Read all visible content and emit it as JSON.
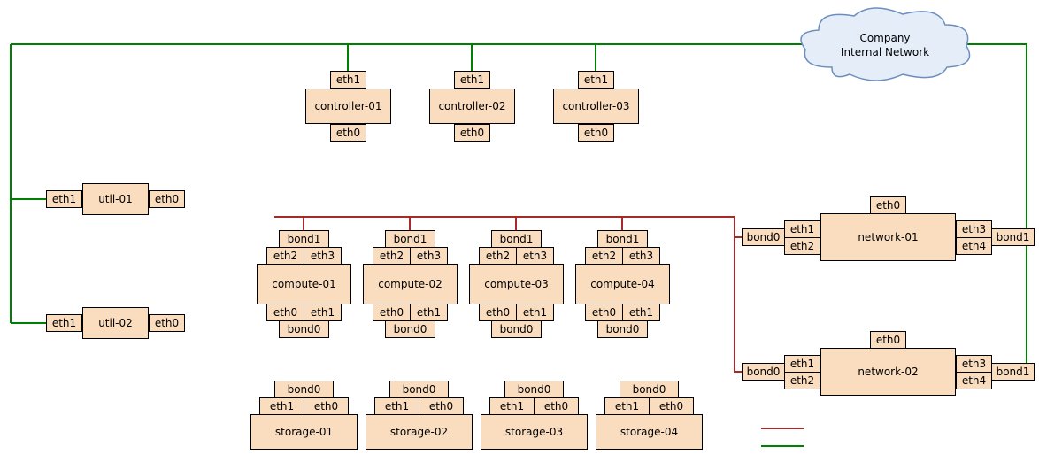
{
  "cloud": {
    "line1": "Company",
    "line2": "Internal Network"
  },
  "controllers": [
    {
      "name": "controller-01",
      "top": "eth1",
      "bottom": "eth0"
    },
    {
      "name": "controller-02",
      "top": "eth1",
      "bottom": "eth0"
    },
    {
      "name": "controller-03",
      "top": "eth1",
      "bottom": "eth0"
    }
  ],
  "utils": [
    {
      "name": "util-01",
      "left": "eth1",
      "right": "eth0"
    },
    {
      "name": "util-02",
      "left": "eth1",
      "right": "eth0"
    }
  ],
  "computes": [
    {
      "name": "compute-01",
      "topBond": "bond1",
      "topA": "eth2",
      "topB": "eth3",
      "botA": "eth0",
      "botB": "eth1",
      "botBond": "bond0"
    },
    {
      "name": "compute-02",
      "topBond": "bond1",
      "topA": "eth2",
      "topB": "eth3",
      "botA": "eth0",
      "botB": "eth1",
      "botBond": "bond0"
    },
    {
      "name": "compute-03",
      "topBond": "bond1",
      "topA": "eth2",
      "topB": "eth3",
      "botA": "eth0",
      "botB": "eth1",
      "botBond": "bond0"
    },
    {
      "name": "compute-04",
      "topBond": "bond1",
      "topA": "eth2",
      "topB": "eth3",
      "botA": "eth0",
      "botB": "eth1",
      "botBond": "bond0"
    }
  ],
  "storages": [
    {
      "name": "storage-01",
      "bond": "bond0",
      "a": "eth1",
      "b": "eth0"
    },
    {
      "name": "storage-02",
      "bond": "bond0",
      "a": "eth1",
      "b": "eth0"
    },
    {
      "name": "storage-03",
      "bond": "bond0",
      "a": "eth1",
      "b": "eth0"
    },
    {
      "name": "storage-04",
      "bond": "bond0",
      "a": "eth1",
      "b": "eth0"
    }
  ],
  "networks": [
    {
      "name": "network-01",
      "top": "eth0",
      "leftBond": "bond0",
      "l1": "eth1",
      "l2": "eth2",
      "r1": "eth3",
      "r2": "eth4",
      "rightBond": "bond1"
    },
    {
      "name": "network-02",
      "top": "eth0",
      "leftBond": "bond0",
      "l1": "eth1",
      "l2": "eth2",
      "r1": "eth3",
      "r2": "eth4",
      "rightBond": "bond1"
    }
  ],
  "colors": {
    "green": "#008000",
    "red": "#a52a2a",
    "node": "#fadcbe",
    "cloud": "#dae8fc"
  }
}
